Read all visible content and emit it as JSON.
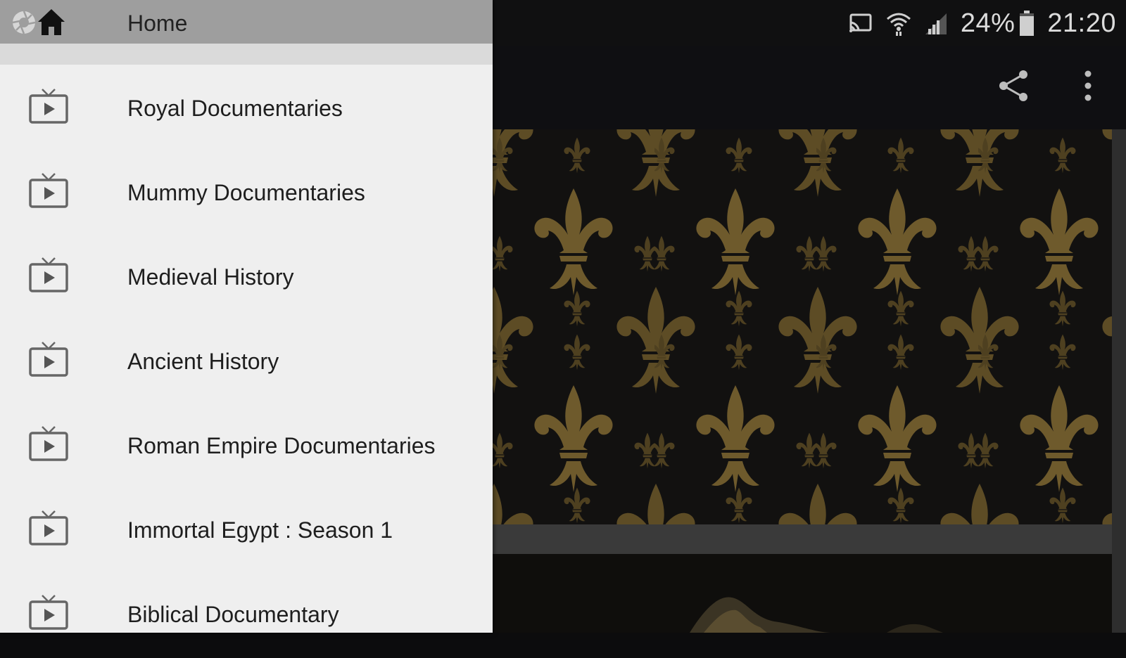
{
  "status_bar": {
    "battery_text": "24%",
    "time": "21:20",
    "icons": [
      "cast-icon",
      "wifi-icon",
      "signal-icon",
      "battery-icon"
    ]
  },
  "toolbar": {
    "actions": [
      "share-icon",
      "more-vert-icon"
    ]
  },
  "drawer": {
    "header": {
      "title": "Home",
      "icons": [
        "camera-aperture-icon",
        "home-icon"
      ]
    },
    "items": [
      {
        "label": "Royal Documentaries",
        "icon": "tv-play-icon"
      },
      {
        "label": "Mummy Documentaries",
        "icon": "tv-play-icon"
      },
      {
        "label": "Medieval History",
        "icon": "tv-play-icon"
      },
      {
        "label": "Ancient History",
        "icon": "tv-play-icon"
      },
      {
        "label": "Roman Empire Documentaries",
        "icon": "tv-play-icon"
      },
      {
        "label": "Immortal Egypt : Season 1",
        "icon": "tv-play-icon"
      },
      {
        "label": "Biblical Documentary",
        "icon": "tv-play-icon"
      }
    ]
  },
  "colors": {
    "drawer_bg": "#efefef",
    "drawer_header": "#9e9e9e",
    "toolbar_bg": "#0f0f12",
    "pattern_gold": "#6e5a2c"
  }
}
